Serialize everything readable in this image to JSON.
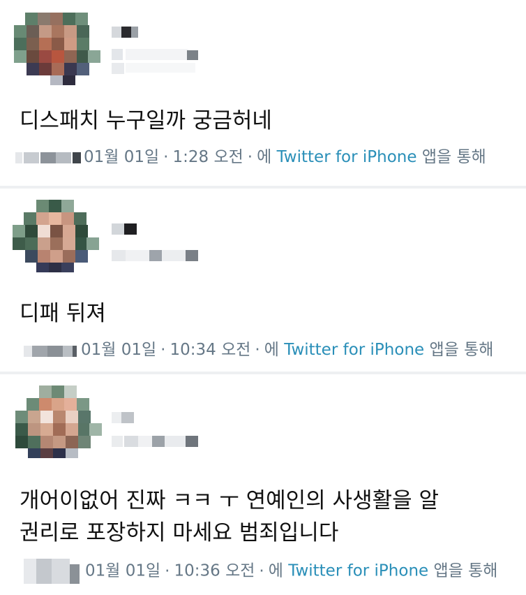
{
  "tweets": [
    {
      "text": "디스패치 누구일까 궁금허네",
      "date": "01월 01일",
      "separator": "·",
      "time": "1:28 오전",
      "via_prefix": "에",
      "app": "Twitter for iPhone",
      "via_suffix": "앱을 통해"
    },
    {
      "text": "디패 뒤져",
      "date": "01월 01일",
      "separator": "·",
      "time": "10:34 오전",
      "via_prefix": "에",
      "app": "Twitter for iPhone",
      "via_suffix": "앱을 통해"
    },
    {
      "text": "개어이없어 진짜 ㅋㅋ ㅜ 연예인의 사생활을 알\n권리로 포장하지 마세요 범죄입니다",
      "date": "01월 01일",
      "separator": "·",
      "time": "10:36 오전",
      "via_prefix": "에",
      "app": "Twitter for iPhone",
      "via_suffix": "앱을 통해"
    }
  ],
  "colors": {
    "link": "#2a8fb8",
    "meta": "#657786",
    "divider": "#eef0f2"
  },
  "icons": {
    "avatar": "pixelated-avatar",
    "name": "blurred-username",
    "handle": "blurred-handle"
  }
}
